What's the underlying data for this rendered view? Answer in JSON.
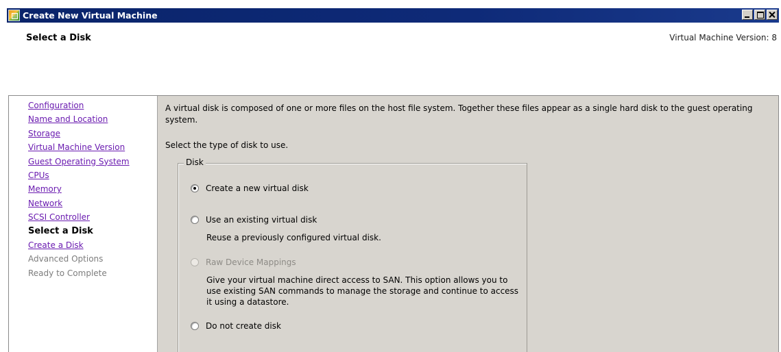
{
  "window": {
    "title": "Create New Virtual Machine"
  },
  "header": {
    "page_title": "Select a Disk",
    "version": "Virtual Machine Version: 8"
  },
  "nav": {
    "items": [
      {
        "label": "Configuration",
        "state": "link"
      },
      {
        "label": "Name and Location",
        "state": "link"
      },
      {
        "label": "Storage",
        "state": "link"
      },
      {
        "label": "Virtual Machine Version",
        "state": "link"
      },
      {
        "label": "Guest Operating System",
        "state": "link"
      },
      {
        "label": "CPUs",
        "state": "link"
      },
      {
        "label": "Memory",
        "state": "link"
      },
      {
        "label": "Network",
        "state": "link"
      },
      {
        "label": "SCSI Controller",
        "state": "link"
      },
      {
        "label": "Select a Disk",
        "state": "current"
      },
      {
        "label": "Create a Disk",
        "state": "link"
      },
      {
        "label": "Advanced Options",
        "state": "disabled"
      },
      {
        "label": "Ready to Complete",
        "state": "disabled"
      }
    ]
  },
  "main": {
    "description": "A virtual disk is composed of one or more files on the host file system. Together these files appear as a single hard disk to the guest operating system.",
    "prompt": "Select the type of disk to use.",
    "disk_group": {
      "legend": "Disk",
      "options": [
        {
          "label": "Create a new virtual disk",
          "checked": true,
          "disabled": false,
          "description": ""
        },
        {
          "label": "Use an existing virtual disk",
          "checked": false,
          "disabled": false,
          "description": "Reuse a previously configured virtual disk."
        },
        {
          "label": "Raw Device Mappings",
          "checked": false,
          "disabled": true,
          "description": "Give your virtual machine direct access to SAN. This option allows you to use existing SAN commands to manage the storage and continue to access it using a datastore."
        },
        {
          "label": "Do not create disk",
          "checked": false,
          "disabled": false,
          "description": ""
        }
      ]
    }
  },
  "colors": {
    "titlebar": "#0a246a",
    "link": "#6a1bb0",
    "panel_bg": "#d8d5cf"
  }
}
